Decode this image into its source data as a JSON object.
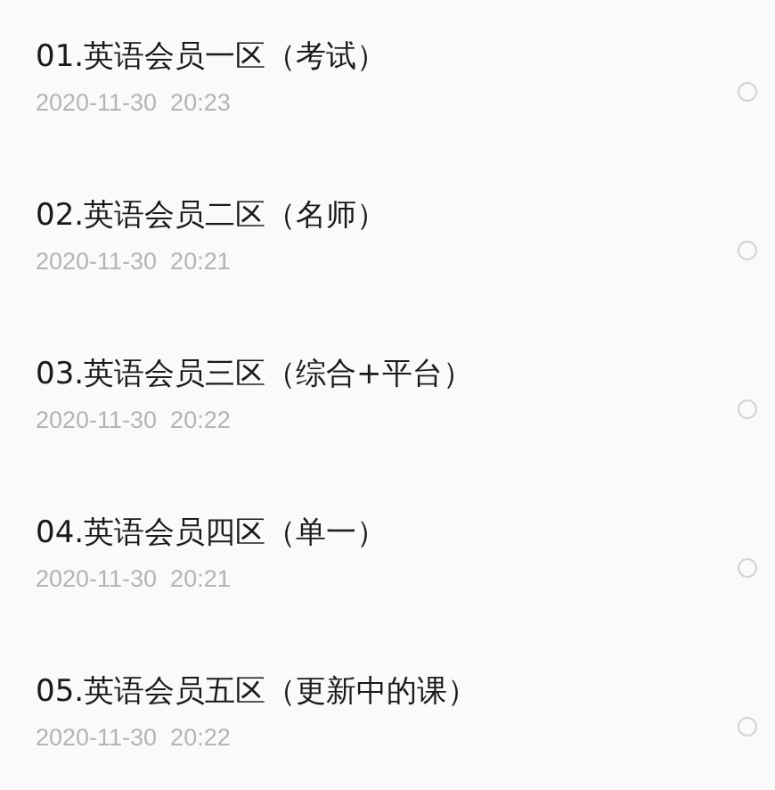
{
  "items": [
    {
      "title": "01.英语会员一区（考试）",
      "time": "2020-11-30  20:23",
      "selected": false
    },
    {
      "title": "02.英语会员二区（名师）",
      "time": "2020-11-30  20:21",
      "selected": false
    },
    {
      "title": "03.英语会员三区（综合+平台）",
      "time": "2020-11-30  20:22",
      "selected": false
    },
    {
      "title": "04.英语会员四区（单一）",
      "time": "2020-11-30  20:21",
      "selected": false
    },
    {
      "title": "05.英语会员五区（更新中的课）",
      "time": "2020-11-30  20:22",
      "selected": false
    }
  ]
}
